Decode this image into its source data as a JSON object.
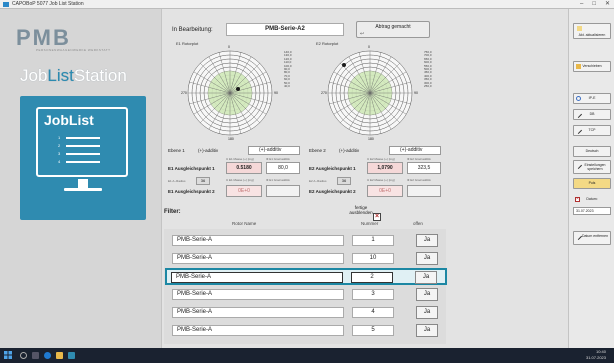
{
  "window": {
    "title": "CAPOBoP 5077 Job List Station"
  },
  "brand": {
    "logo": "PMB",
    "logo_sub": "PERSONENWAAGENWERKE WERKSTATT",
    "station_a": "Job",
    "station_b": "List",
    "station_c": "Station"
  },
  "joblist": {
    "title": "JobList",
    "numbers": [
      "1",
      "2",
      "3",
      "4"
    ]
  },
  "header": {
    "in_bearbeitung_label": "In Bearbeitung:",
    "current_serie": "PMB-Serie-A2",
    "abtrag_label": "Abtrag gemacht"
  },
  "polar_left": {
    "title": "E1 Rotorplot",
    "ticks": [
      "0",
      "90",
      "180",
      "270"
    ],
    "scale": [
      "140,0",
      "130,0",
      "120,0",
      "110,0",
      "100,0",
      "90,0",
      "80,0",
      "70,0",
      "60,0",
      "50,0",
      "40,0"
    ]
  },
  "polar_right": {
    "title": "E2 Rotorplot",
    "ticks": [
      "0",
      "90",
      "180",
      "270"
    ],
    "scale": [
      "750,0",
      "700,0",
      "650,0",
      "600,0",
      "550,0",
      "500,0",
      "450,0",
      "400,0",
      "350,0",
      "300,0",
      "250,0"
    ]
  },
  "ebene1": {
    "ebene_label": "Ebene 1",
    "mode": "(+)-additiv",
    "mode_select": "(+)-additiv",
    "p1_label": "E1 Ausgleichspunkt 1",
    "p1_mass_label": "U E1 Masse (+) [mg]",
    "p1_mass": "0.5180",
    "p1_grad_label": "Φ E1 Grad additiv",
    "p1_grad": "80,0",
    "radius_label": "E1 A.-Radius",
    "radius": "36",
    "p2_mass_label": "U E1 Masse (+) [mg]",
    "p2_grad_label": "Φ E1 Grad additiv",
    "p2_label": "E1 Ausgleichspunkt 2",
    "p2_value": "0E+0"
  },
  "ebene2": {
    "ebene_label": "Ebene 2",
    "mode": "(+)-additiv",
    "mode_select": "(+)-additiv",
    "p1_label": "E2 Ausgleichspunkt 1",
    "p1_mass_label": "U E2 Masse (+) [mg]",
    "p1_mass": "1,0790",
    "p1_grad_label": "Φ E2 Grad additiv",
    "p1_grad": "323,5",
    "radius_label": "E2 A.-Radius",
    "radius": "36",
    "p2_mass_label": "U E2 Masse (+) [mg]",
    "p2_grad_label": "Φ E2 Grad additiv",
    "p2_label": "E2 Ausgleichspunkt 2",
    "p2_value": "0E+0"
  },
  "filter": {
    "label": "Filter:",
    "fertige_label": "fertige ausblenden",
    "checked": true
  },
  "table": {
    "headers": {
      "name": "Rotor Name",
      "number": "Nummer",
      "open": "offen"
    },
    "rows": [
      {
        "name": "PMB-Serie-A",
        "number": "1",
        "open": "Ja",
        "selected": false
      },
      {
        "name": "PMB-Serie-A",
        "number": "10",
        "open": "Ja",
        "selected": false
      },
      {
        "name": "PMB-Serie-A",
        "number": "2",
        "open": "Ja",
        "selected": true
      },
      {
        "name": "PMB-Serie-A",
        "number": "3",
        "open": "Ja",
        "selected": false
      },
      {
        "name": "PMB-Serie-A",
        "number": "4",
        "open": "Ja",
        "selected": false
      },
      {
        "name": "PMB-Serie-A",
        "number": "5",
        "open": "Ja",
        "selected": false
      }
    ]
  },
  "sidebar": {
    "btn_aktualisieren": "Akt. aktualisieren",
    "btn_verschieben": "Verschieben",
    "btn_ip": "IP-E",
    "btn_db": "DB",
    "btn_tcp": "TCP",
    "btn_deutsch": "Deutsch",
    "btn_einstellungen": "Einstellungen speichern",
    "btn_puls": "Puls",
    "datum_label": "Datum:",
    "datum_value": "31.07.2023",
    "btn_datum_entfernen": "Datum entfernen"
  },
  "taskbar": {
    "time": "10:40",
    "date": "31.07.2023"
  },
  "colors": {
    "accent": "#2f8bb0",
    "selected_border": "#1c87a3",
    "value_red": "#f5d8d8",
    "button_yellow": "#f3d985"
  }
}
